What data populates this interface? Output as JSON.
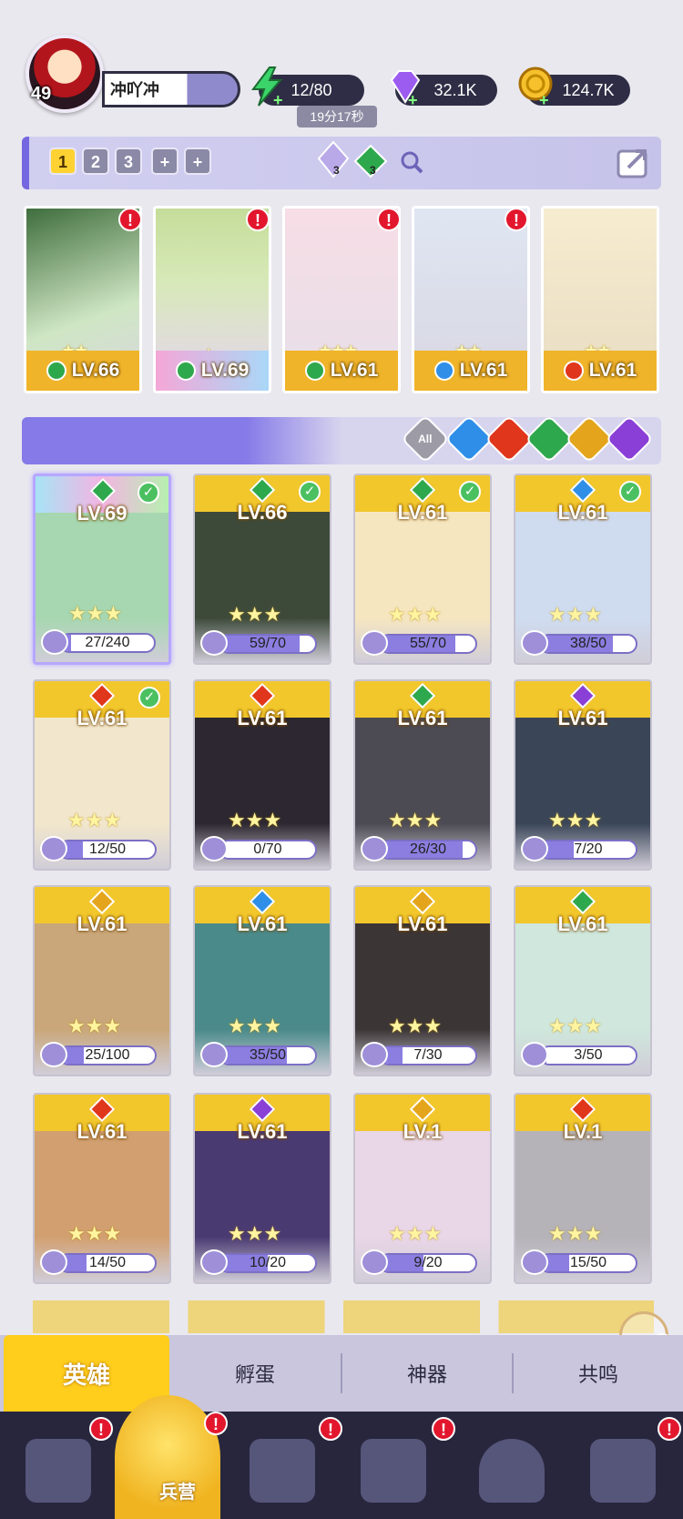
{
  "player": {
    "level": "49",
    "name": "冲吖冲"
  },
  "resources": {
    "energy": "12/80",
    "energy_timer": "19分17秒",
    "gems": "32.1K",
    "coins": "124.7K"
  },
  "team": {
    "tabs": [
      "1",
      "2",
      "3",
      "+",
      "+"
    ],
    "active_tab": "1",
    "counters": [
      "3",
      "3"
    ]
  },
  "team_cards": [
    {
      "level": "LV.66",
      "element": "green",
      "stars": "★★"
    },
    {
      "level": "LV.69",
      "element": "green",
      "stars": "★"
    },
    {
      "level": "LV.61",
      "element": "green",
      "stars": "★★★"
    },
    {
      "level": "LV.61",
      "element": "blue",
      "stars": "★★"
    },
    {
      "level": "LV.61",
      "element": "red",
      "stars": "★★"
    }
  ],
  "filters": {
    "all_label": "All",
    "elements": [
      "blue",
      "red",
      "green",
      "gold",
      "purple"
    ]
  },
  "colors": {
    "blue": "#2f8fe8",
    "red": "#e0361c",
    "green": "#2ea84c",
    "gold": "#e4a51c",
    "purple": "#8a3fd6"
  },
  "heroes": [
    {
      "level": "LV.69",
      "progress": "27/240",
      "frac": 0.11,
      "element": "green",
      "checked": true,
      "selected": true
    },
    {
      "level": "LV.66",
      "progress": "59/70",
      "frac": 0.84,
      "element": "green",
      "checked": true
    },
    {
      "level": "LV.61",
      "progress": "55/70",
      "frac": 0.79,
      "element": "green",
      "checked": true
    },
    {
      "level": "LV.61",
      "progress": "38/50",
      "frac": 0.76,
      "element": "blue",
      "checked": true
    },
    {
      "level": "LV.61",
      "progress": "12/50",
      "frac": 0.24,
      "element": "red",
      "checked": true
    },
    {
      "level": "LV.61",
      "progress": "0/70",
      "frac": 0,
      "element": "red"
    },
    {
      "level": "LV.61",
      "progress": "26/30",
      "frac": 0.87,
      "element": "green"
    },
    {
      "level": "LV.61",
      "progress": "7/20",
      "frac": 0.35,
      "element": "purple"
    },
    {
      "level": "LV.61",
      "progress": "25/100",
      "frac": 0.25,
      "element": "gold"
    },
    {
      "level": "LV.61",
      "progress": "35/50",
      "frac": 0.7,
      "element": "blue"
    },
    {
      "level": "LV.61",
      "progress": "7/30",
      "frac": 0.23,
      "element": "gold"
    },
    {
      "level": "LV.61",
      "progress": "3/50",
      "frac": 0.06,
      "element": "green"
    },
    {
      "level": "LV.61",
      "progress": "14/50",
      "frac": 0.28,
      "element": "red"
    },
    {
      "level": "LV.61",
      "progress": "10/20",
      "frac": 0.5,
      "element": "purple"
    },
    {
      "level": "LV.1",
      "progress": "9/20",
      "frac": 0.45,
      "element": "gold"
    },
    {
      "level": "LV.1",
      "progress": "15/50",
      "frac": 0.3,
      "element": "red"
    }
  ],
  "tabs": [
    "英雄",
    "孵蛋",
    "神器",
    "共鸣"
  ],
  "nav": {
    "active_label": "兵营"
  }
}
